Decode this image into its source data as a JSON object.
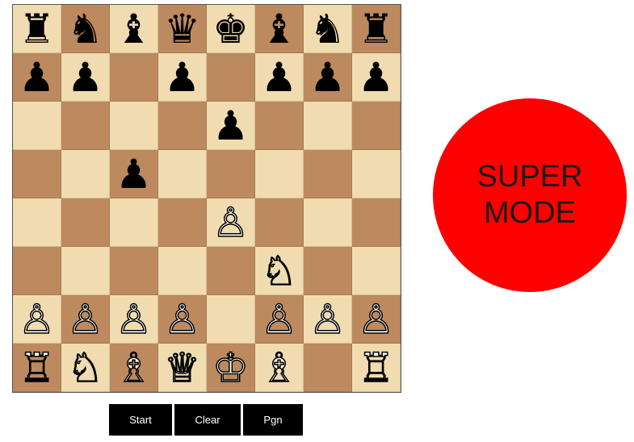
{
  "colors": {
    "light_square": "#f0dcb0",
    "dark_square": "#bc8a5e",
    "super_mode": "#ff0000"
  },
  "board": {
    "rows": [
      [
        "♜",
        "♞",
        "♝",
        "♛",
        "♚",
        "♝",
        "♞",
        "♜"
      ],
      [
        "♟",
        "♟",
        "",
        "♟",
        "",
        "♟",
        "♟",
        "♟"
      ],
      [
        "",
        "",
        "",
        "",
        "♟",
        "",
        "",
        ""
      ],
      [
        "",
        "",
        "♟",
        "",
        "",
        "",
        "",
        ""
      ],
      [
        "",
        "",
        "",
        "",
        "♙",
        "",
        "",
        ""
      ],
      [
        "",
        "",
        "",
        "",
        "",
        "♘",
        "",
        ""
      ],
      [
        "♙",
        "♙",
        "♙",
        "♙",
        "",
        "♙",
        "♙",
        "♙"
      ],
      [
        "♖",
        "♘",
        "♗",
        "♕",
        "♔",
        "♗",
        "",
        "♖"
      ]
    ]
  },
  "controls": {
    "start_label": "Start",
    "clear_label": "Clear",
    "pgn_label": "Pgn"
  },
  "super_mode": {
    "line1": "SUPER",
    "line2": "MODE"
  }
}
